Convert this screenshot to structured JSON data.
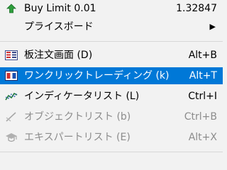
{
  "menu": {
    "items": [
      {
        "label": "Buy Limit 0.01",
        "shortcut": "1.32847",
        "icon": "green-up-arrow-icon"
      },
      {
        "label": "プライスボード",
        "submenu_arrow": "▶"
      },
      {
        "label": "板注文画面 (D)",
        "shortcut": "Alt+B",
        "icon": "market-depth-icon"
      },
      {
        "label": "ワンクリックトレーディング (k)",
        "shortcut": "Alt+T",
        "icon": "one-click-trading-icon"
      },
      {
        "label": "インディケータリスト (L)",
        "shortcut": "Ctrl+I",
        "icon": "indicators-icon"
      },
      {
        "label": "オブジェクトリスト (b)",
        "shortcut": "Ctrl+B",
        "icon": "objects-icon"
      },
      {
        "label": "エキスパートリスト (E)",
        "shortcut": "Alt+X",
        "icon": "experts-icon"
      }
    ]
  },
  "colors": {
    "selection": "#0078d7",
    "background": "#f2f2f2",
    "disabled_text": "#8c8c8c"
  }
}
